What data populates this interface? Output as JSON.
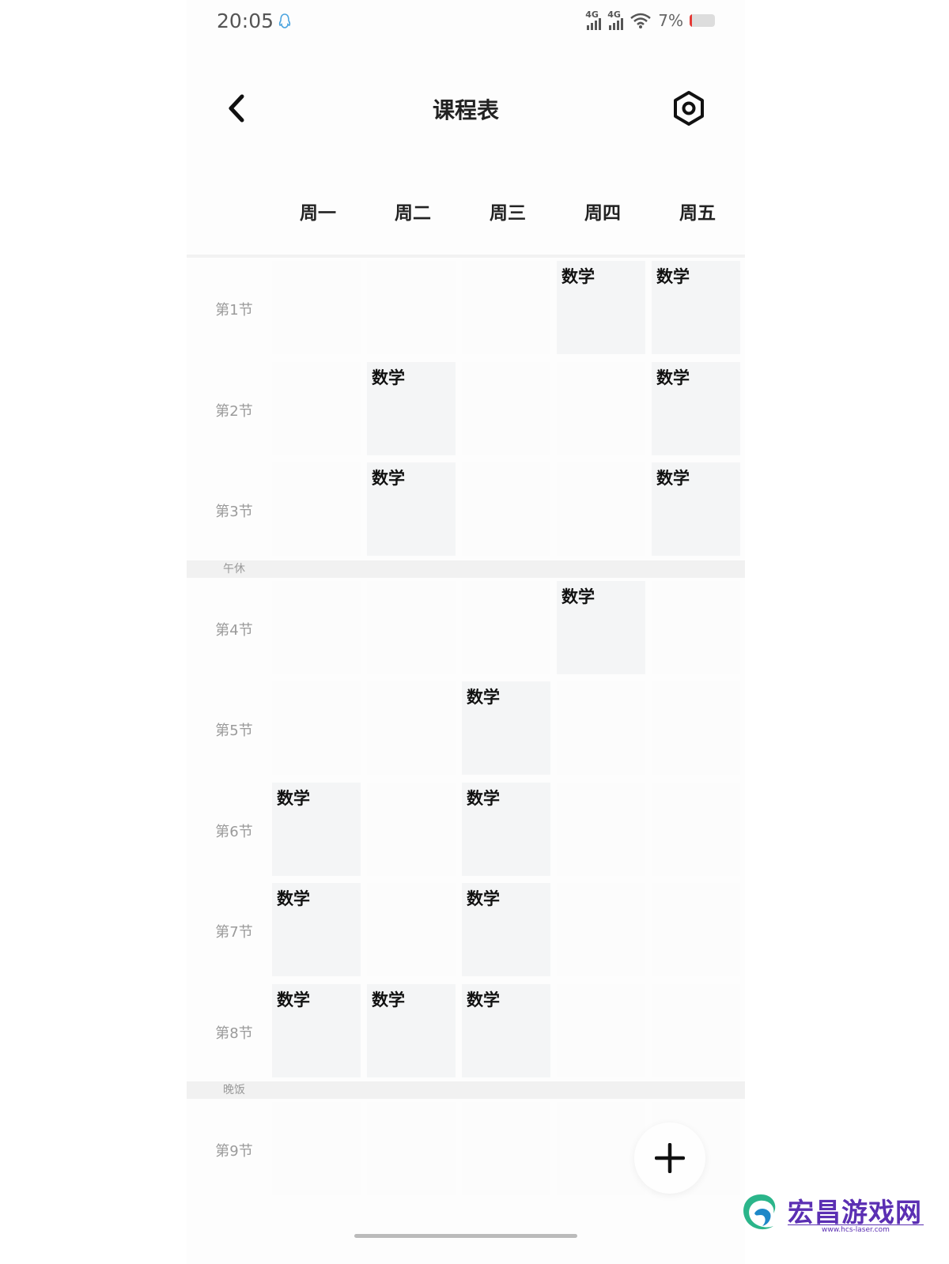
{
  "status_bar": {
    "time": "20:05",
    "qq_icon": "qq-notification-icon",
    "signal_labels": [
      "4G",
      "4G"
    ],
    "battery_text": "7%",
    "battery_level": 0.07,
    "battery_color": "#e53935"
  },
  "header": {
    "title": "课程表",
    "back_icon": "chevron-left-icon",
    "settings_icon": "settings-ring-icon"
  },
  "days": [
    "周一",
    "周二",
    "周三",
    "周四",
    "周五"
  ],
  "periods": [
    "第1节",
    "第2节",
    "第3节",
    "第4节",
    "第5节",
    "第6节",
    "第7节",
    "第8节",
    "第9节"
  ],
  "breaks": {
    "lunch": "午休",
    "dinner": "晚饭"
  },
  "course_name": "数学",
  "schedule": [
    [
      null,
      null,
      null,
      "数学",
      "数学"
    ],
    [
      null,
      "数学",
      null,
      null,
      "数学"
    ],
    [
      null,
      "数学",
      null,
      null,
      "数学"
    ],
    [
      null,
      null,
      null,
      "数学",
      null
    ],
    [
      null,
      null,
      "数学",
      null,
      null
    ],
    [
      "数学",
      null,
      "数学",
      null,
      null
    ],
    [
      "数学",
      null,
      "数学",
      null,
      null
    ],
    [
      "数学",
      "数学",
      "数学",
      null,
      null
    ],
    [
      null,
      null,
      null,
      null,
      null
    ]
  ],
  "fab": {
    "icon": "plus-icon"
  },
  "watermark": {
    "logo_icon": "swirl-logo-icon",
    "text": "宏昌游戏网",
    "url": "www.hcs-laser.com"
  },
  "colors": {
    "course_bg": "#f4f5f6",
    "brand_watermark": "#5b2fb3"
  }
}
